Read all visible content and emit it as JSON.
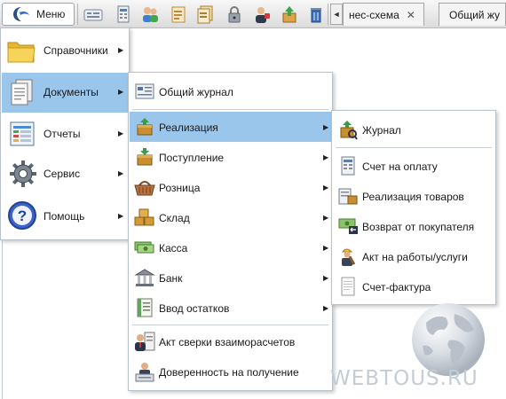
{
  "toolbar": {
    "menu_label": "Меню",
    "icons": [
      "calculator-icon",
      "ledger-icon",
      "users-icon",
      "document-icon",
      "documents-icon",
      "lock-icon",
      "user-manager-icon",
      "upload-icon",
      "trash-icon"
    ],
    "tabs": [
      {
        "label": "нес-схема",
        "close": "✕"
      },
      {
        "label": "Общий жу"
      }
    ],
    "tab_scroll": "◄"
  },
  "main_menu": {
    "items": [
      {
        "label": "Справочники",
        "icon": "folder-icon",
        "arrow": "▶"
      },
      {
        "label": "Документы",
        "icon": "documents-icon",
        "arrow": "▶",
        "selected": true
      },
      {
        "label": "Отчеты",
        "icon": "reports-icon",
        "arrow": "▶"
      },
      {
        "label": "Сервис",
        "icon": "gear-icon",
        "arrow": "▶"
      },
      {
        "label": "Помощь",
        "icon": "help-icon",
        "arrow": "▶"
      }
    ]
  },
  "documents_menu": {
    "items": [
      {
        "label": "Общий журнал",
        "icon": "journal-icon"
      },
      {
        "label": "Реализация",
        "icon": "sales-box-icon",
        "arrow": "▶",
        "selected": true
      },
      {
        "label": "Поступление",
        "icon": "receipt-box-icon",
        "arrow": "▶"
      },
      {
        "label": "Розница",
        "icon": "basket-icon",
        "arrow": "▶"
      },
      {
        "label": "Склад",
        "icon": "warehouse-icon",
        "arrow": "▶"
      },
      {
        "label": "Касса",
        "icon": "cash-icon",
        "arrow": "▶"
      },
      {
        "label": "Банк",
        "icon": "bank-icon",
        "arrow": "▶"
      },
      {
        "label": "Ввод остатков",
        "icon": "balances-icon",
        "arrow": "▶"
      },
      {
        "label": "Акт сверки взаиморасчетов",
        "icon": "reconciliation-icon"
      },
      {
        "label": "Доверенность на получение",
        "icon": "power-of-attorney-icon"
      }
    ]
  },
  "sales_menu": {
    "items": [
      {
        "label": "Журнал",
        "icon": "sales-journal-icon"
      },
      {
        "label": "Счет на оплату",
        "icon": "invoice-icon"
      },
      {
        "label": "Реализация товаров",
        "icon": "goods-sale-icon"
      },
      {
        "label": "Возврат от покупателя",
        "icon": "return-icon"
      },
      {
        "label": "Акт на работы/услуги",
        "icon": "work-act-icon"
      },
      {
        "label": "Счет-фактура",
        "icon": "tax-invoice-icon"
      }
    ]
  },
  "watermark": {
    "text": "WEBTOUS.RU"
  }
}
